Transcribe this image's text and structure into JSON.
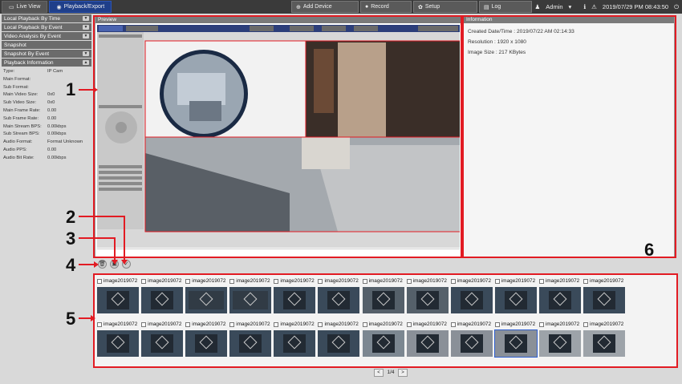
{
  "topbar": {
    "tabs": [
      {
        "label": "Live View",
        "icon": "monitor-icon"
      },
      {
        "label": "Playback/Export",
        "icon": "play-circle-icon"
      }
    ],
    "add_device": "Add Device",
    "record": "Record",
    "setup": "Setup",
    "log": "Log",
    "user": "Admin",
    "datetime": "2019/07/29 PM 08:43:50"
  },
  "sidebar": {
    "sections": [
      "Local Playback By Time",
      "Local Playback By Event",
      "Video Analysis By Event",
      "Snapshot",
      "Snapshot By Event",
      "Playback Information"
    ],
    "info": [
      {
        "k": "Type:",
        "v": "IP Cam"
      },
      {
        "k": "Main Format:",
        "v": ""
      },
      {
        "k": "Sub Format:",
        "v": ""
      },
      {
        "k": "Main Video Size:",
        "v": "0x0"
      },
      {
        "k": "Sub Video Size:",
        "v": "0x0"
      },
      {
        "k": "Main Frame Rate:",
        "v": "0.00"
      },
      {
        "k": "Sub Frame Rate:",
        "v": "0.00"
      },
      {
        "k": "Main Stream BPS:",
        "v": "0.00kbps"
      },
      {
        "k": "Sub Stream BPS:",
        "v": "0.00kbps"
      },
      {
        "k": "Audio Format:",
        "v": "Format Unknown"
      },
      {
        "k": "Audio PPS:",
        "v": "0.00"
      },
      {
        "k": "Audio Bit Rate:",
        "v": "0.00kbps"
      }
    ]
  },
  "preview": {
    "title": "Preview"
  },
  "information": {
    "title": "Information",
    "created": "Created Date/Time : 2019/07/22      AM 02:14:33",
    "resolution": "Resolution : 1920 x 1080",
    "image_size": "Image Size : 217 KBytes"
  },
  "callouts": [
    "1",
    "2",
    "3",
    "4",
    "5",
    "6"
  ],
  "thumbnails": {
    "label": "image2019072",
    "count": 24,
    "selected_index": 21
  },
  "pager": {
    "prev": "<",
    "page": "1/4",
    "next": ">"
  }
}
